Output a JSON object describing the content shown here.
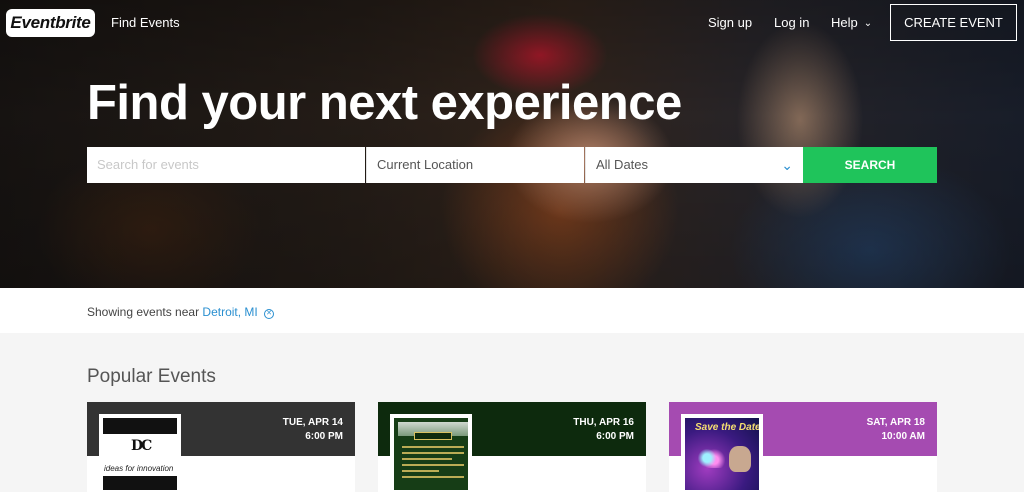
{
  "header": {
    "logo_text": "Eventbrite",
    "find_events": "Find Events",
    "sign_up": "Sign up",
    "log_in": "Log in",
    "help": "Help",
    "help_icon": "chevron-down-icon",
    "create_event": "CREATE EVENT"
  },
  "hero": {
    "headline": "Find your next experience"
  },
  "search": {
    "placeholder": "Search for events",
    "location": "Current Location",
    "dates": "All Dates",
    "dates_icon": "chevron-down-icon",
    "button": "SEARCH"
  },
  "location_bar": {
    "prefix": "Showing events near",
    "location": "Detroit, MI",
    "clear_icon": "close-circle-icon"
  },
  "popular": {
    "title": "Popular Events",
    "cards": [
      {
        "day": "TUE, APR 14",
        "time": "6:00 PM",
        "band_color": "#333333",
        "thumb_caption": "ideas for innovation",
        "thumb_mark": "DC"
      },
      {
        "day": "THU, APR 16",
        "time": "6:00 PM",
        "band_color": "#0d2a0d"
      },
      {
        "day": "SAT, APR 18",
        "time": "10:00 AM",
        "band_color": "#a54bb1",
        "thumb_title": "Save the Date"
      }
    ]
  },
  "colors": {
    "accent_green": "#1fc45b",
    "link_blue": "#2a8fd0"
  }
}
